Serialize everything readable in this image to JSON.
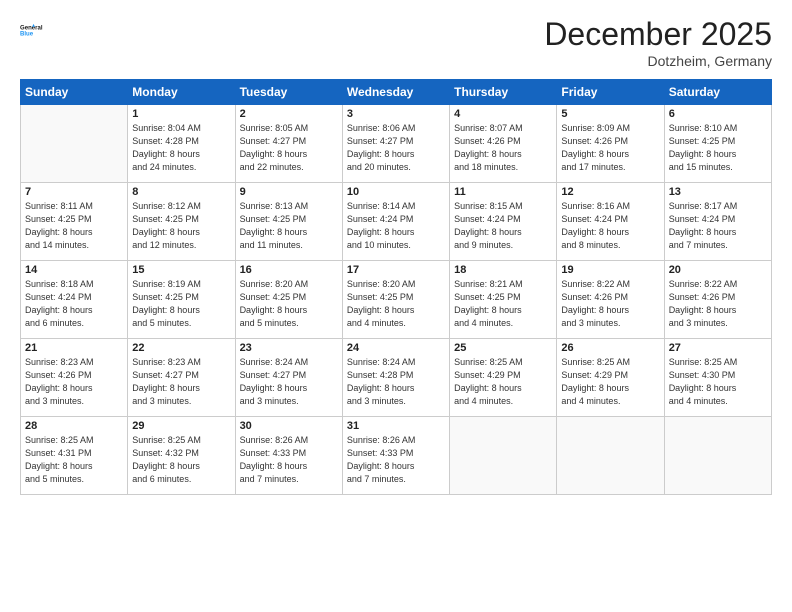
{
  "header": {
    "logo_line1": "General",
    "logo_line2": "Blue",
    "month_title": "December 2025",
    "subtitle": "Dotzheim, Germany"
  },
  "weekdays": [
    "Sunday",
    "Monday",
    "Tuesday",
    "Wednesday",
    "Thursday",
    "Friday",
    "Saturday"
  ],
  "weeks": [
    [
      {
        "day": "",
        "info": ""
      },
      {
        "day": "1",
        "info": "Sunrise: 8:04 AM\nSunset: 4:28 PM\nDaylight: 8 hours\nand 24 minutes."
      },
      {
        "day": "2",
        "info": "Sunrise: 8:05 AM\nSunset: 4:27 PM\nDaylight: 8 hours\nand 22 minutes."
      },
      {
        "day": "3",
        "info": "Sunrise: 8:06 AM\nSunset: 4:27 PM\nDaylight: 8 hours\nand 20 minutes."
      },
      {
        "day": "4",
        "info": "Sunrise: 8:07 AM\nSunset: 4:26 PM\nDaylight: 8 hours\nand 18 minutes."
      },
      {
        "day": "5",
        "info": "Sunrise: 8:09 AM\nSunset: 4:26 PM\nDaylight: 8 hours\nand 17 minutes."
      },
      {
        "day": "6",
        "info": "Sunrise: 8:10 AM\nSunset: 4:25 PM\nDaylight: 8 hours\nand 15 minutes."
      }
    ],
    [
      {
        "day": "7",
        "info": "Sunrise: 8:11 AM\nSunset: 4:25 PM\nDaylight: 8 hours\nand 14 minutes."
      },
      {
        "day": "8",
        "info": "Sunrise: 8:12 AM\nSunset: 4:25 PM\nDaylight: 8 hours\nand 12 minutes."
      },
      {
        "day": "9",
        "info": "Sunrise: 8:13 AM\nSunset: 4:25 PM\nDaylight: 8 hours\nand 11 minutes."
      },
      {
        "day": "10",
        "info": "Sunrise: 8:14 AM\nSunset: 4:24 PM\nDaylight: 8 hours\nand 10 minutes."
      },
      {
        "day": "11",
        "info": "Sunrise: 8:15 AM\nSunset: 4:24 PM\nDaylight: 8 hours\nand 9 minutes."
      },
      {
        "day": "12",
        "info": "Sunrise: 8:16 AM\nSunset: 4:24 PM\nDaylight: 8 hours\nand 8 minutes."
      },
      {
        "day": "13",
        "info": "Sunrise: 8:17 AM\nSunset: 4:24 PM\nDaylight: 8 hours\nand 7 minutes."
      }
    ],
    [
      {
        "day": "14",
        "info": "Sunrise: 8:18 AM\nSunset: 4:24 PM\nDaylight: 8 hours\nand 6 minutes."
      },
      {
        "day": "15",
        "info": "Sunrise: 8:19 AM\nSunset: 4:25 PM\nDaylight: 8 hours\nand 5 minutes."
      },
      {
        "day": "16",
        "info": "Sunrise: 8:20 AM\nSunset: 4:25 PM\nDaylight: 8 hours\nand 5 minutes."
      },
      {
        "day": "17",
        "info": "Sunrise: 8:20 AM\nSunset: 4:25 PM\nDaylight: 8 hours\nand 4 minutes."
      },
      {
        "day": "18",
        "info": "Sunrise: 8:21 AM\nSunset: 4:25 PM\nDaylight: 8 hours\nand 4 minutes."
      },
      {
        "day": "19",
        "info": "Sunrise: 8:22 AM\nSunset: 4:26 PM\nDaylight: 8 hours\nand 3 minutes."
      },
      {
        "day": "20",
        "info": "Sunrise: 8:22 AM\nSunset: 4:26 PM\nDaylight: 8 hours\nand 3 minutes."
      }
    ],
    [
      {
        "day": "21",
        "info": "Sunrise: 8:23 AM\nSunset: 4:26 PM\nDaylight: 8 hours\nand 3 minutes."
      },
      {
        "day": "22",
        "info": "Sunrise: 8:23 AM\nSunset: 4:27 PM\nDaylight: 8 hours\nand 3 minutes."
      },
      {
        "day": "23",
        "info": "Sunrise: 8:24 AM\nSunset: 4:27 PM\nDaylight: 8 hours\nand 3 minutes."
      },
      {
        "day": "24",
        "info": "Sunrise: 8:24 AM\nSunset: 4:28 PM\nDaylight: 8 hours\nand 3 minutes."
      },
      {
        "day": "25",
        "info": "Sunrise: 8:25 AM\nSunset: 4:29 PM\nDaylight: 8 hours\nand 4 minutes."
      },
      {
        "day": "26",
        "info": "Sunrise: 8:25 AM\nSunset: 4:29 PM\nDaylight: 8 hours\nand 4 minutes."
      },
      {
        "day": "27",
        "info": "Sunrise: 8:25 AM\nSunset: 4:30 PM\nDaylight: 8 hours\nand 4 minutes."
      }
    ],
    [
      {
        "day": "28",
        "info": "Sunrise: 8:25 AM\nSunset: 4:31 PM\nDaylight: 8 hours\nand 5 minutes."
      },
      {
        "day": "29",
        "info": "Sunrise: 8:25 AM\nSunset: 4:32 PM\nDaylight: 8 hours\nand 6 minutes."
      },
      {
        "day": "30",
        "info": "Sunrise: 8:26 AM\nSunset: 4:33 PM\nDaylight: 8 hours\nand 7 minutes."
      },
      {
        "day": "31",
        "info": "Sunrise: 8:26 AM\nSunset: 4:33 PM\nDaylight: 8 hours\nand 7 minutes."
      },
      {
        "day": "",
        "info": ""
      },
      {
        "day": "",
        "info": ""
      },
      {
        "day": "",
        "info": ""
      }
    ]
  ]
}
